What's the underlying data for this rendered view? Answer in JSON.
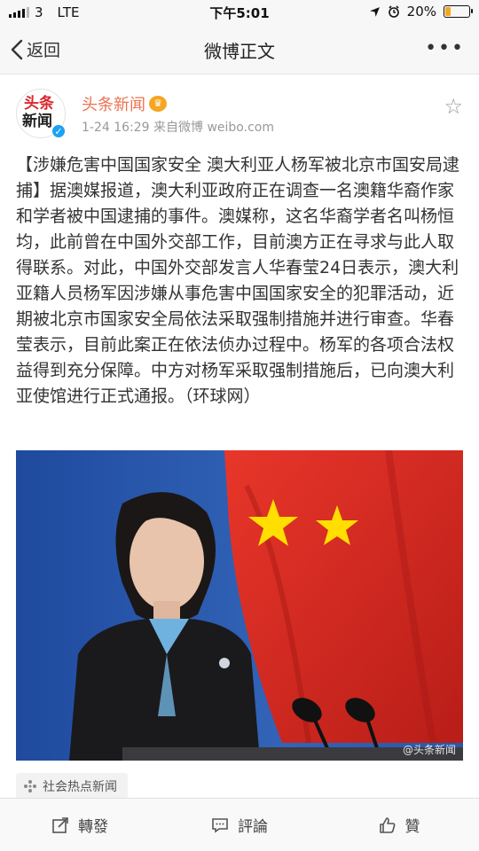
{
  "status_bar": {
    "carrier": "3",
    "network": "LTE",
    "time": "下午5:01",
    "battery": "20%",
    "battery_level": 0.2
  },
  "nav": {
    "back_label": "返回",
    "title": "微博正文",
    "more": "•••"
  },
  "post": {
    "avatar_line1": "头条",
    "avatar_line2": "新闻",
    "author": "头条新闻",
    "meta": "1-24 16:29  来自微博 weibo.com",
    "text": "【涉嫌危害中国国家安全 澳大利亚人杨军被北京市国安局逮捕】据澳媒报道，澳大利亚政府正在调查一名澳籍华裔作家和学者被中国逮捕的事件。澳媒称，这名华裔学者名叫杨恒均，此前曾在中国外交部工作，目前澳方正在寻求与此人取得联系。对此，中国外交部发言人华春莹24日表示，澳大利亚籍人员杨军因涉嫌从事危害中国国家安全的犯罪活动，近期被北京市国家安全局依法采取强制措施并进行审查。华春莹表示，目前此案正在依法侦办过程中。杨军的各项合法权益得到充分保障。中方对杨军采取强制措施后，已向澳大利亚使馆进行正式通报。（环球网）",
    "image_watermark": "@头条新闻"
  },
  "topic": {
    "label": "社会热点新闻"
  },
  "toolbar": {
    "repost": "轉發",
    "comment": "評論",
    "like": "贊"
  },
  "colors": {
    "author": "#eb7350",
    "flag_red": "#d62820",
    "backdrop_blue": "#2a55a8"
  }
}
